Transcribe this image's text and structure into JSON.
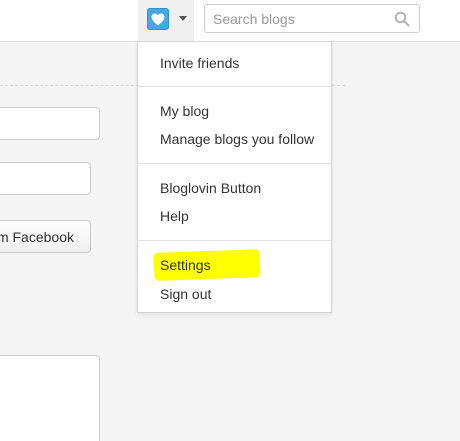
{
  "header": {
    "logo_icon": "heart-icon",
    "logo_color": "#44a9e2",
    "dropdown_icon": "chevron-down-icon",
    "search": {
      "placeholder": "Search blogs",
      "value": "",
      "icon": "search-icon"
    }
  },
  "background": {
    "facebook_button_label": "m Facebook"
  },
  "menu": {
    "invite_friends": "Invite friends",
    "my_blog": "My blog",
    "manage_blogs": "Manage blogs you follow",
    "bloglovin_button": "Bloglovin Button",
    "help": "Help",
    "settings": "Settings",
    "sign_out": "Sign out",
    "settings_highlight_color": "#ffff00"
  }
}
